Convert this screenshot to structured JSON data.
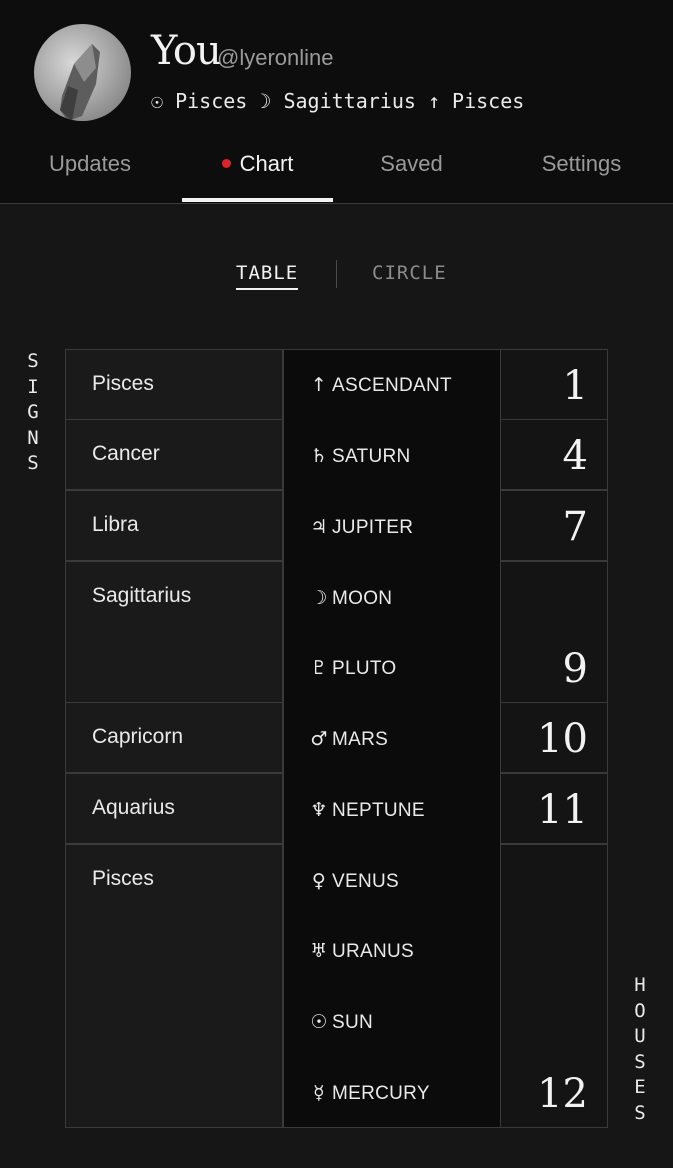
{
  "profile": {
    "name": "You",
    "handle": "@lyeronline",
    "placements": "☉ Pisces ☽ Sagittarius ↑ Pisces"
  },
  "tabs": [
    {
      "label": "Updates",
      "active": false
    },
    {
      "label": "Chart",
      "active": true
    },
    {
      "label": "Saved",
      "active": false
    },
    {
      "label": "Settings",
      "active": false
    }
  ],
  "view_toggle": {
    "table": "TABLE",
    "circle": "CIRCLE",
    "selected": "TABLE"
  },
  "side_labels": {
    "signs": "SIGNS",
    "houses": "HOUSES"
  },
  "signs": [
    "Pisces",
    "Cancer",
    "Libra",
    "Sagittarius",
    "Capricorn",
    "Aquarius",
    "Pisces"
  ],
  "planets": [
    {
      "glyph": "↑",
      "name": "ASCENDANT"
    },
    {
      "glyph": "♄",
      "name": "SATURN"
    },
    {
      "glyph": "♃",
      "name": "JUPITER"
    },
    {
      "glyph": "☽",
      "name": "MOON"
    },
    {
      "glyph": "♇",
      "name": "PLUTO"
    },
    {
      "glyph": "♂",
      "name": "MARS"
    },
    {
      "glyph": "♆",
      "name": "NEPTUNE"
    },
    {
      "glyph": "♀",
      "name": "VENUS"
    },
    {
      "glyph": "♅",
      "name": "URANUS"
    },
    {
      "glyph": "☉",
      "name": "SUN"
    },
    {
      "glyph": "☿",
      "name": "MERCURY"
    }
  ],
  "houses": [
    "1",
    "4",
    "7",
    "9",
    "10",
    "11",
    "12"
  ],
  "colors": {
    "accent_dot": "#e3212b",
    "background": "#161616",
    "header": "#0d0d0d"
  }
}
